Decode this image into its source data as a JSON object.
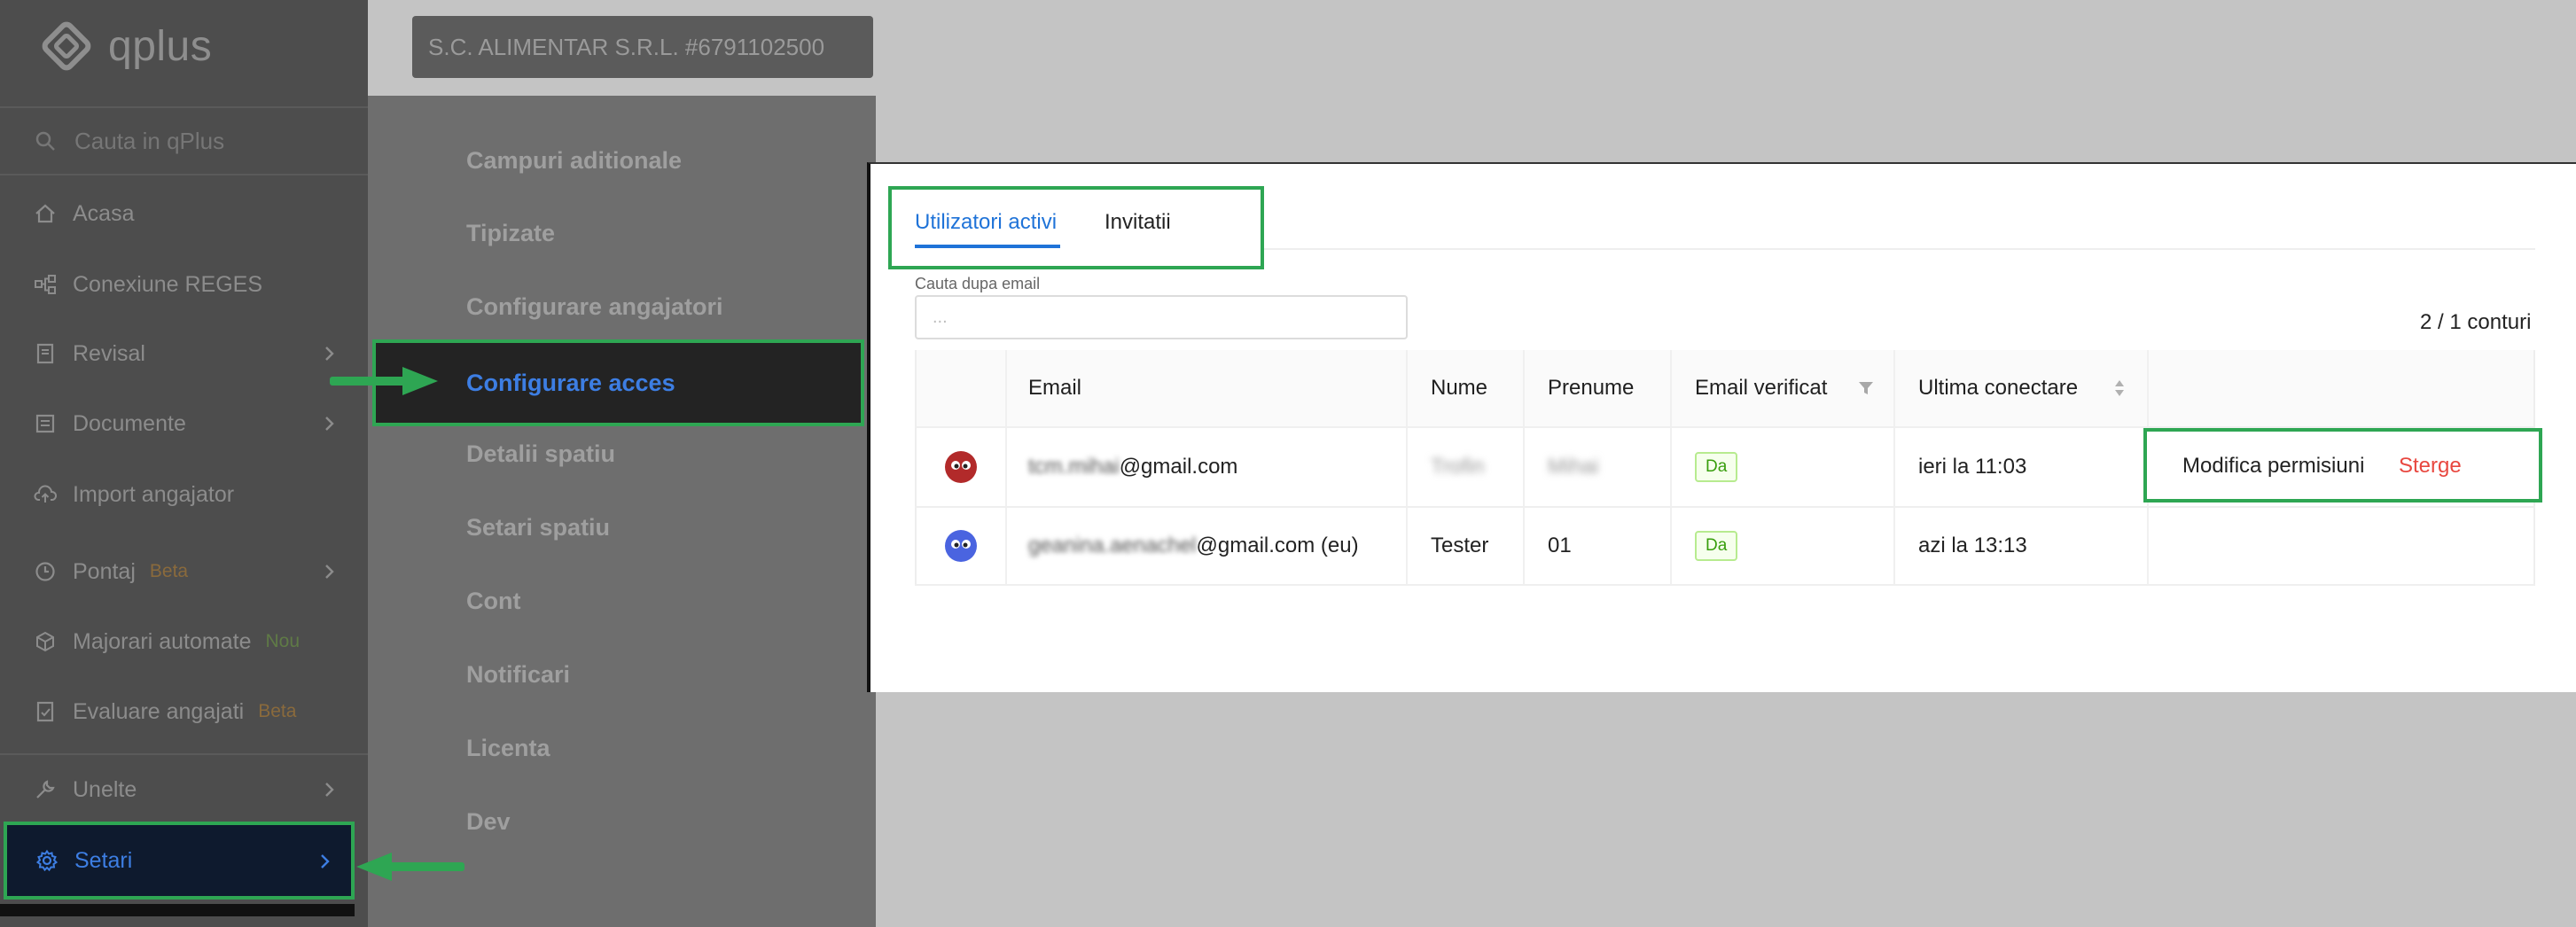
{
  "app": {
    "name": "qplus"
  },
  "search": {
    "placeholder": "Cauta in qPlus"
  },
  "company": {
    "label": "S.C. ALIMENTAR S.R.L. #6791102500"
  },
  "sidebar": {
    "items": [
      {
        "label": "Acasa",
        "icon": "home-icon"
      },
      {
        "label": "Conexiune REGES",
        "icon": "network-icon"
      },
      {
        "label": "Revisal",
        "icon": "document-icon"
      },
      {
        "label": "Documente",
        "icon": "documents-icon"
      },
      {
        "label": "Import angajator",
        "icon": "cloud-upload-icon"
      },
      {
        "label": "Pontaj",
        "icon": "clock-icon",
        "badge": "Beta"
      },
      {
        "label": "Majorari automate",
        "icon": "cube-icon",
        "badge": "Nou"
      },
      {
        "label": "Evaluare angajati",
        "icon": "evaluation-icon",
        "badge": "Beta"
      },
      {
        "label": "Unelte",
        "icon": "wrench-icon"
      },
      {
        "label": "Setari",
        "icon": "gear-icon",
        "active": true
      }
    ]
  },
  "submenu": {
    "items": [
      "Campuri aditionale",
      "Tipizate",
      "Configurare angajatori",
      "Configurare acces",
      "Detalii spatiu",
      "Setari spatiu",
      "Cont",
      "Notificari",
      "Licenta",
      "Dev"
    ],
    "active": "Configurare acces"
  },
  "tabs": {
    "active": "Utilizatori activi",
    "other": "Invitatii"
  },
  "filter": {
    "label": "Cauta dupa email",
    "placeholder": "..."
  },
  "count": "2 / 1 conturi",
  "table": {
    "headers": [
      "Email",
      "Nume",
      "Prenume",
      "Email verificat",
      "Ultima conectare"
    ],
    "rows": [
      {
        "email_hidden": "tcm.mihai",
        "email_domain": "@gmail.com",
        "nume": "Trofin",
        "prenume": "Mihai",
        "verificat": "Da",
        "ultima": "ieri la 11:03",
        "avatar_color": "#b22a2a"
      },
      {
        "email_hidden": "geanina.aenachel",
        "email_domain": "@gmail.com (eu)",
        "nume": "Tester",
        "prenume": "01",
        "verificat": "Da",
        "ultima": "azi la 13:13",
        "avatar_color": "#4a64e0"
      }
    ],
    "actions": {
      "edit": "Modifica permisiuni",
      "delete": "Sterge"
    }
  },
  "colors": {
    "accent": "#1f73d8",
    "highlight": "#2ea653",
    "danger": "#e8473f",
    "sidebar_bg": "#4d4d4d",
    "active_nav_bg": "#0e1a2e"
  }
}
